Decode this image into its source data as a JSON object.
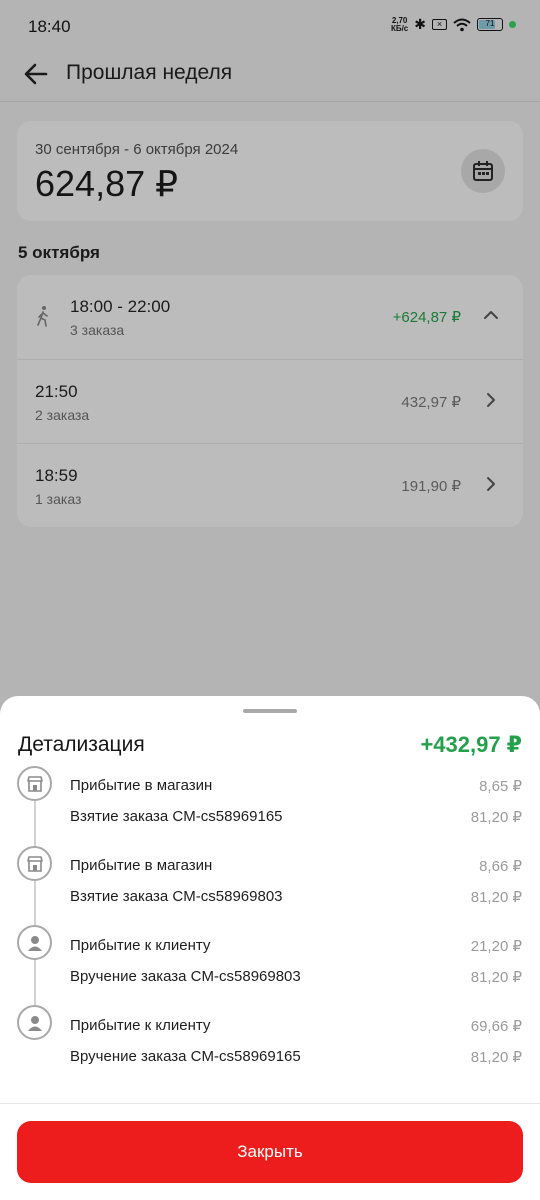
{
  "status_bar": {
    "time": "18:40",
    "speed_top": "2,70",
    "speed_bottom": "КБ/с",
    "battery": "71"
  },
  "header": {
    "title": "Прошлая неделя"
  },
  "summary": {
    "period": "30 сентября - 6 октября 2024",
    "total": "624,87 ₽"
  },
  "day": {
    "title": "5 октября"
  },
  "orders": [
    {
      "main": "18:00 - 22:00",
      "sub": "3 заказа",
      "amount": "+624,87 ₽"
    },
    {
      "main": "21:50",
      "sub": "2 заказа",
      "amount": "432,97 ₽"
    },
    {
      "main": "18:59",
      "sub": "1 заказ",
      "amount": "191,90 ₽"
    }
  ],
  "sheet": {
    "title": "Детализация",
    "total": "+432,97 ₽",
    "steps": [
      {
        "icon": "store-icon",
        "line1": "Прибытие в магазин",
        "value1": "8,65 ₽",
        "line2": "Взятие заказа CM-cs58969165",
        "value2": "81,20 ₽"
      },
      {
        "icon": "store-icon",
        "line1": "Прибытие в магазин",
        "value1": "8,66 ₽",
        "line2": "Взятие заказа CM-cs58969803",
        "value2": "81,20 ₽"
      },
      {
        "icon": "person-icon",
        "line1": "Прибытие к клиенту",
        "value1": "21,20 ₽",
        "line2": "Вручение заказа CM-cs58969803",
        "value2": "81,20 ₽"
      },
      {
        "icon": "person-icon",
        "line1": "Прибытие к клиенту",
        "value1": "69,66 ₽",
        "line2": "Вручение заказа CM-cs58969165",
        "value2": "81,20 ₽"
      }
    ],
    "close_label": "Закрыть"
  },
  "colors": {
    "accent_red": "#ee1d1d",
    "positive_green": "#23a04a",
    "overlay_gray": "#b4b4b4"
  }
}
